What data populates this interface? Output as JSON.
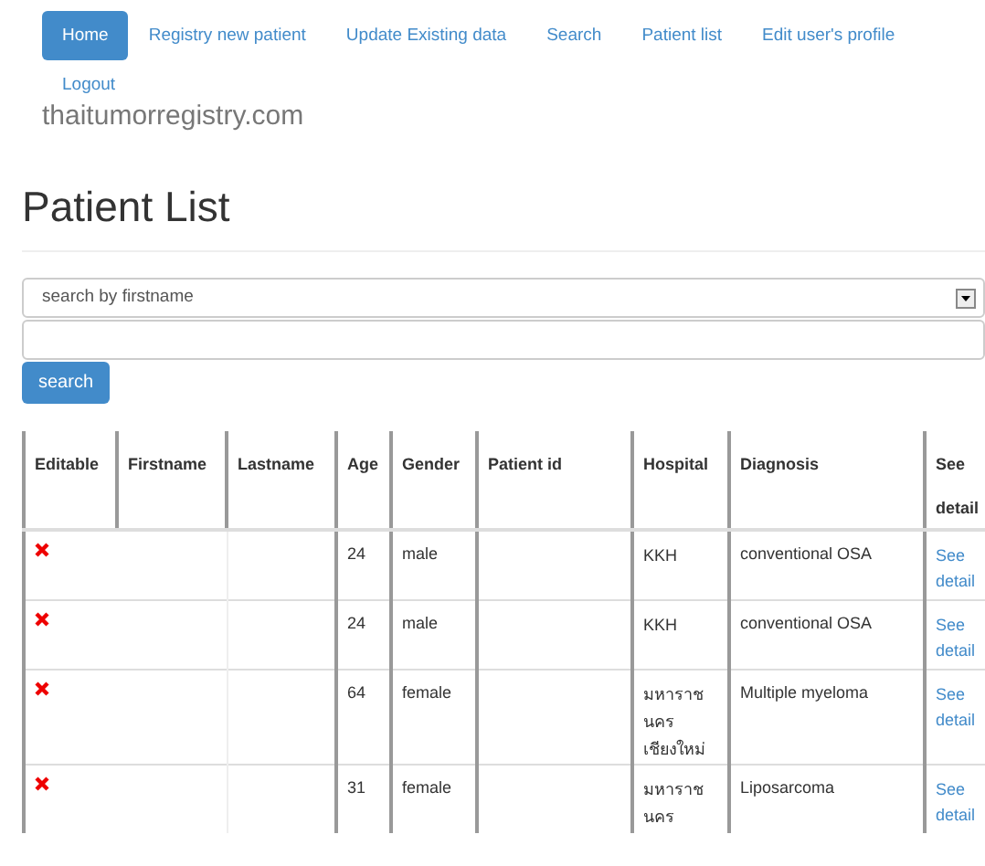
{
  "nav": [
    {
      "label": "Home",
      "selected": true
    },
    {
      "label": "Registry new patient",
      "selected": false
    },
    {
      "label": "Update Existing data",
      "selected": false
    },
    {
      "label": "Search",
      "selected": false
    },
    {
      "label": "Patient list",
      "selected": false
    },
    {
      "label": "Edit user's profile",
      "selected": false
    },
    {
      "label": "Logout",
      "selected": false
    }
  ],
  "brand": "thaitumorregistry.com",
  "heading": "Patient List",
  "search": {
    "select_value": "search by firstname",
    "button": "search"
  },
  "table": {
    "columns": [
      "Editable",
      "Firstname",
      "Lastname",
      "Age",
      "Gender",
      "Patient id",
      "Hospital",
      "Diagnosis",
      "See detail"
    ],
    "rows": [
      {
        "editable": false,
        "age": "24",
        "gender": "male",
        "hospital": "KKH",
        "diagnosis": "conventional OSA",
        "link": "See detail"
      },
      {
        "editable": false,
        "age": "24",
        "gender": "male",
        "hospital": "KKH",
        "diagnosis": "conventional OSA",
        "link": "See detail"
      },
      {
        "editable": false,
        "age": "64",
        "gender": "female",
        "hospital": "มหาราช นคร เชียงใหม่",
        "diagnosis": "Multiple myeloma",
        "link": "See detail"
      },
      {
        "editable": false,
        "age": "31",
        "gender": "female",
        "hospital": "มหาราช นคร",
        "diagnosis": "Liposarcoma",
        "link": "See detail"
      }
    ]
  }
}
